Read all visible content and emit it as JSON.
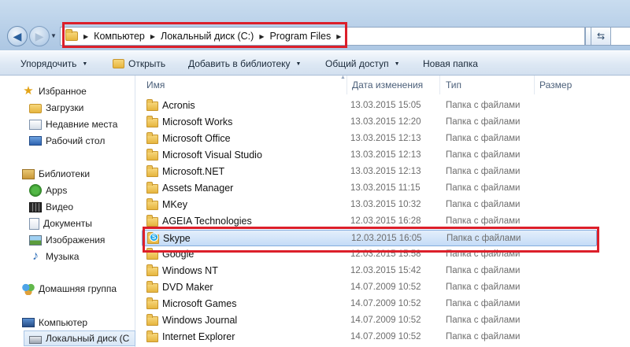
{
  "address_bar": {
    "crumbs": [
      "Компьютер",
      "Локальный диск (C:)",
      "Program Files"
    ]
  },
  "toolbar": {
    "organize": "Упорядочить",
    "open": "Открыть",
    "add_to_library": "Добавить в библиотеку",
    "share": "Общий доступ",
    "new_folder": "Новая папка"
  },
  "nav": {
    "favorites": "Избранное",
    "downloads": "Загрузки",
    "recent": "Недавние места",
    "desktop": "Рабочий стол",
    "libraries": "Библиотеки",
    "apps": "Apps",
    "video": "Видео",
    "documents": "Документы",
    "images": "Изображения",
    "music": "Музыка",
    "homegroup": "Домашняя группа",
    "computer": "Компьютер",
    "local_disk": "Локальный диск (C"
  },
  "columns": {
    "name": "Имя",
    "date": "Дата изменения",
    "type": "Тип",
    "size": "Размер"
  },
  "files": [
    {
      "name": "Acronis",
      "date": "13.03.2015 15:05",
      "type": "Папка с файлами"
    },
    {
      "name": "Microsoft Works",
      "date": "13.03.2015 12:20",
      "type": "Папка с файлами"
    },
    {
      "name": "Microsoft Office",
      "date": "13.03.2015 12:13",
      "type": "Папка с файлами"
    },
    {
      "name": "Microsoft Visual Studio",
      "date": "13.03.2015 12:13",
      "type": "Папка с файлами"
    },
    {
      "name": "Microsoft.NET",
      "date": "13.03.2015 12:13",
      "type": "Папка с файлами"
    },
    {
      "name": "Assets Manager",
      "date": "13.03.2015 11:15",
      "type": "Папка с файлами"
    },
    {
      "name": "MKey",
      "date": "13.03.2015 10:32",
      "type": "Папка с файлами"
    },
    {
      "name": "AGEIA Technologies",
      "date": "12.03.2015 16:28",
      "type": "Папка с файлами"
    },
    {
      "name": "Skype",
      "date": "12.03.2015 16:05",
      "type": "Папка с файлами"
    },
    {
      "name": "Google",
      "date": "12.03.2015 15:58",
      "type": "Папка с файлами"
    },
    {
      "name": "Windows NT",
      "date": "12.03.2015 15:42",
      "type": "Папка с файлами"
    },
    {
      "name": "DVD Maker",
      "date": "14.07.2009 10:52",
      "type": "Папка с файлами"
    },
    {
      "name": "Microsoft Games",
      "date": "14.07.2009 10:52",
      "type": "Папка с файлами"
    },
    {
      "name": "Windows Journal",
      "date": "14.07.2009 10:52",
      "type": "Папка с файлами"
    },
    {
      "name": "Internet Explorer",
      "date": "14.07.2009 10:52",
      "type": "Папка с файлами"
    }
  ],
  "colors": {
    "highlight": "#dc1f2a",
    "selection": "#c4dcf7"
  }
}
